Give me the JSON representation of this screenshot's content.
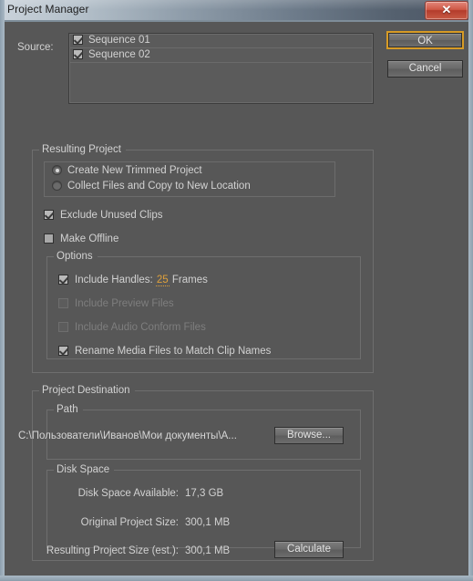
{
  "window": {
    "title": "Project Manager",
    "close_label": "✕",
    "accent_color": "#d79b26",
    "titlebar_color": "#4a5564",
    "background_color": "#575757"
  },
  "source": {
    "label": "Source:",
    "items": [
      {
        "label": "Sequence 01",
        "checked": true
      },
      {
        "label": "Sequence 02",
        "checked": true
      }
    ]
  },
  "buttons": {
    "ok": "OK",
    "cancel": "Cancel",
    "browse": "Browse...",
    "calculate": "Calculate"
  },
  "resulting_project": {
    "title": "Resulting Project",
    "radios": [
      {
        "label": "Create New Trimmed Project",
        "selected": true
      },
      {
        "label": "Collect Files and Copy to New Location",
        "selected": false
      }
    ],
    "exclude_unused_clips": {
      "label": "Exclude Unused Clips",
      "checked": true,
      "enabled": true
    },
    "make_offline": {
      "label": "Make Offline",
      "checked": false,
      "enabled": true
    },
    "options": {
      "title": "Options",
      "include_handles": {
        "label": "Include Handles:",
        "checked": true,
        "enabled": true,
        "value": "25",
        "unit": "Frames"
      },
      "include_preview_files": {
        "label": "Include Preview Files",
        "checked": false,
        "enabled": false
      },
      "include_audio_conform_files": {
        "label": "Include Audio Conform Files",
        "checked": false,
        "enabled": false
      },
      "rename_media_files": {
        "label": "Rename Media Files to Match Clip Names",
        "checked": true,
        "enabled": true
      }
    }
  },
  "project_destination": {
    "title": "Project Destination",
    "path": {
      "title": "Path",
      "value": "C:\\Пользователи\\Иванов\\Мои документы\\A..."
    },
    "disk_space": {
      "title": "Disk Space",
      "rows": [
        {
          "key": "Disk Space Available:",
          "value": "17,3 GB"
        },
        {
          "key": "Original Project Size:",
          "value": "300,1 MB"
        },
        {
          "key": "Resulting Project Size (est.):",
          "value": "300,1 MB"
        }
      ]
    }
  }
}
